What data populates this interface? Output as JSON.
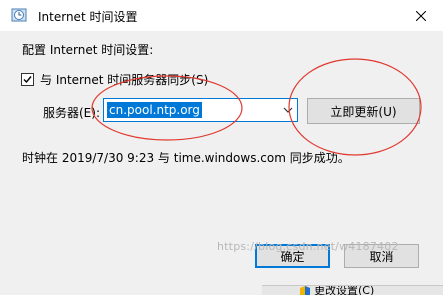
{
  "window": {
    "title": "Internet 时间设置"
  },
  "dialog": {
    "heading": "配置 Internet 时间设置:",
    "sync_checkbox": {
      "label": "与 Internet 时间服务器同步(S)",
      "checked": true
    },
    "server_label": "服务器(E):",
    "server_value": "cn.pool.ntp.org",
    "update_button": "立即更新(U)",
    "status": "时钟在 2019/7/30 9:23 与 time.windows.com 同步成功。",
    "ok_button": "确定",
    "cancel_button": "取消"
  },
  "watermark": "https://blog.csdn.net/w4187402",
  "underlying_window": {
    "text": "更改设置(C)"
  },
  "colors": {
    "accent": "#0078d7",
    "annotation": "#e0392f",
    "face": "#f0f0f0"
  }
}
